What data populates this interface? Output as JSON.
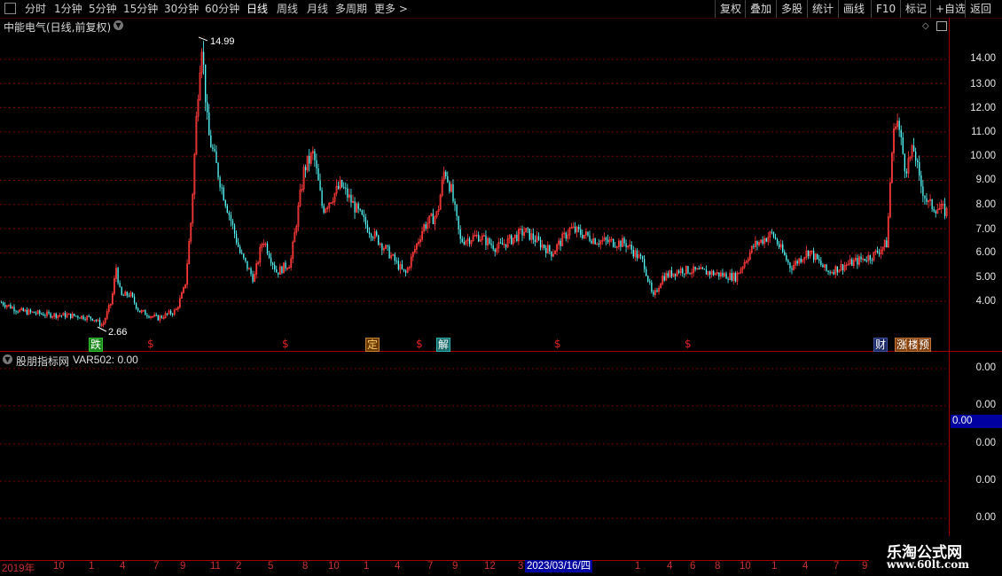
{
  "toolbar": {
    "periods": [
      "分时",
      "1分钟",
      "5分钟",
      "15分钟",
      "30分钟",
      "60分钟",
      "日线",
      "周线",
      "月线",
      "多周期",
      "更多 >"
    ],
    "active_period": "日线",
    "right_buttons": [
      "复权",
      "叠加",
      "多股",
      "统计",
      "画线",
      "F10",
      "标记",
      "+自选",
      "返回"
    ]
  },
  "main": {
    "title": "中能电气(日线,前复权)",
    "y_ticks": [
      "14.00",
      "13.00",
      "12.00",
      "11.00",
      "10.00",
      "9.00",
      "8.00",
      "7.00",
      "6.00",
      "5.00",
      "4.00"
    ],
    "high_label": "14.99",
    "low_label": "2.66",
    "markers": [
      {
        "text": "跌",
        "color": "#ffffff",
        "bg": "#20a020"
      },
      {
        "text": "$",
        "color": "#e02020",
        "bg": ""
      },
      {
        "text": "$",
        "color": "#e02020",
        "bg": ""
      },
      {
        "text": "定",
        "color": "#ffcc66",
        "bg": "#6a3a00"
      },
      {
        "text": "$",
        "color": "#e02020",
        "bg": ""
      },
      {
        "text": "解",
        "color": "#ffffff",
        "bg": "#208080"
      },
      {
        "text": "$",
        "color": "#e02020",
        "bg": ""
      },
      {
        "text": "$",
        "color": "#e02020",
        "bg": ""
      },
      {
        "text": "财",
        "color": "#ffffff",
        "bg": "#203070"
      },
      {
        "text": "涨",
        "color": "#ffffff",
        "bg": "#804010"
      },
      {
        "text": "楼",
        "color": "#ffffff",
        "bg": "#804010"
      },
      {
        "text": "预",
        "color": "#ffffff",
        "bg": "#804010"
      }
    ],
    "colors": {
      "up": "#ff3a3a",
      "down": "#54ffff",
      "grid": "#700000"
    }
  },
  "indicator": {
    "name": "股朋指标网",
    "var_text": "VAR502: 0.00",
    "y_ticks": [
      "0.00",
      "0.00",
      "0.00",
      "0.00",
      "0.00"
    ],
    "current_value": "0.00"
  },
  "datebar": {
    "labels": [
      "2019年",
      "10",
      "1",
      "4",
      "7",
      "9",
      "11",
      "2",
      "5",
      "8",
      "10",
      "1",
      "4",
      "7",
      "9",
      "12",
      "3",
      "2023/03/16/四",
      "1",
      "4",
      "6",
      "8",
      "10",
      "1",
      "4",
      "7",
      "9"
    ]
  },
  "watermark": {
    "title": "乐淘公式网",
    "url": "www.60lt.com"
  },
  "chart_data": {
    "type": "candlestick",
    "title": "中能电气(日线,前复权)",
    "ylim": [
      2.5,
      15.2
    ],
    "y_ticks": [
      4,
      5,
      6,
      7,
      8,
      9,
      10,
      11,
      12,
      13,
      14
    ],
    "max_label": 14.99,
    "min_label": 2.66,
    "price_path": [
      [
        0,
        3.95
      ],
      [
        0.02,
        3.6
      ],
      [
        0.05,
        3.45
      ],
      [
        0.08,
        3.4
      ],
      [
        0.1,
        3.3
      ],
      [
        0.11,
        3.0
      ],
      [
        0.12,
        4.0
      ],
      [
        0.125,
        5.4
      ],
      [
        0.13,
        4.2
      ],
      [
        0.14,
        4.3
      ],
      [
        0.15,
        3.6
      ],
      [
        0.17,
        3.3
      ],
      [
        0.19,
        3.6
      ],
      [
        0.2,
        4.6
      ],
      [
        0.207,
        7.5
      ],
      [
        0.213,
        12.0
      ],
      [
        0.218,
        14.9
      ],
      [
        0.225,
        11.0
      ],
      [
        0.24,
        8.7
      ],
      [
        0.26,
        6.0
      ],
      [
        0.275,
        4.9
      ],
      [
        0.285,
        6.6
      ],
      [
        0.3,
        5.2
      ],
      [
        0.315,
        5.6
      ],
      [
        0.33,
        9.5
      ],
      [
        0.34,
        10.1
      ],
      [
        0.35,
        7.8
      ],
      [
        0.37,
        8.8
      ],
      [
        0.38,
        8.2
      ],
      [
        0.4,
        7.0
      ],
      [
        0.42,
        6.1
      ],
      [
        0.44,
        5.1
      ],
      [
        0.46,
        7.1
      ],
      [
        0.475,
        7.6
      ],
      [
        0.483,
        9.5
      ],
      [
        0.49,
        8.6
      ],
      [
        0.5,
        6.5
      ],
      [
        0.52,
        6.7
      ],
      [
        0.54,
        6.2
      ],
      [
        0.57,
        6.9
      ],
      [
        0.6,
        6.0
      ],
      [
        0.62,
        7.0
      ],
      [
        0.65,
        6.5
      ],
      [
        0.68,
        6.4
      ],
      [
        0.7,
        5.6
      ],
      [
        0.71,
        4.1
      ],
      [
        0.72,
        5.0
      ],
      [
        0.74,
        5.3
      ],
      [
        0.77,
        5.2
      ],
      [
        0.8,
        5.0
      ],
      [
        0.82,
        6.3
      ],
      [
        0.84,
        6.8
      ],
      [
        0.86,
        5.4
      ],
      [
        0.88,
        6.1
      ],
      [
        0.9,
        5.2
      ],
      [
        0.92,
        5.5
      ],
      [
        0.95,
        5.9
      ],
      [
        0.965,
        6.4
      ],
      [
        0.97,
        10.0
      ],
      [
        0.975,
        11.8
      ],
      [
        0.985,
        9.5
      ],
      [
        0.995,
        10.3
      ],
      [
        1.0,
        9.0
      ],
      [
        1.01,
        8.0
      ],
      [
        1.03,
        7.7
      ]
    ],
    "indicator_series": {
      "name": "VAR502",
      "value": 0.0
    }
  }
}
